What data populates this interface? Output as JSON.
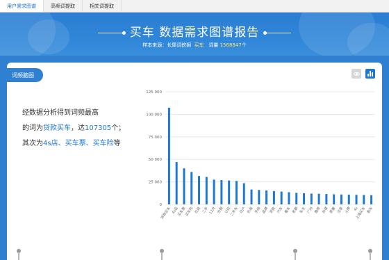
{
  "tabs": [
    {
      "label": "用户需求图谱",
      "active": true
    },
    {
      "label": "高频词提取",
      "active": false
    },
    {
      "label": "相关词提取",
      "active": false
    }
  ],
  "header": {
    "title": "买车 数据需求图谱报告",
    "source_label": "样本来源：",
    "source_value": "长尾词挖掘",
    "keyword": "买车",
    "count_label": "词量",
    "count_value": "1568847",
    "count_unit": "个"
  },
  "card": {
    "tag": "词频脑图",
    "icons": {
      "view": "eye-icon",
      "chart": "bar-chart-icon"
    },
    "accent": "#1f78d1"
  },
  "summary": {
    "line1": "经数据分析得到词频最高",
    "line2_prefix": "的词为",
    "top_word": "贷款买车",
    "line2_mid": "，达",
    "top_count": "107305",
    "line2_suffix": "个；",
    "line3_prefix": "其次为",
    "others": "4s店、买车票、买车险",
    "line3_suffix": "等"
  },
  "chart_data": {
    "type": "bar",
    "yticks": [
      "0",
      "25 000",
      "50 000",
      "75 000",
      "100 000",
      "125 000"
    ],
    "ylim": [
      0,
      125000
    ],
    "color": "#1f78d1",
    "grid": true,
    "categories": [
      "贷款买车",
      "4s店",
      "买车票",
      "买车险",
      "比较",
      "二手",
      "12月",
      "分期",
      "以旧",
      "二手车",
      "过户",
      "价格",
      "手续",
      "品牌",
      "贷款",
      "汽车",
      "看车",
      "名额",
      "车主",
      "广州",
      "推荐",
      "办理",
      "质量",
      "注意",
      "上牌",
      "4s",
      "上海买车",
      "新车"
    ],
    "values": [
      107305,
      47000,
      40000,
      36000,
      31500,
      30500,
      27500,
      27000,
      26500,
      26000,
      23500,
      16500,
      16000,
      15500,
      14800,
      14200,
      13500,
      12800,
      12400,
      12000,
      11800,
      11500,
      11200,
      11000,
      10800,
      10600,
      10400,
      10200
    ]
  }
}
